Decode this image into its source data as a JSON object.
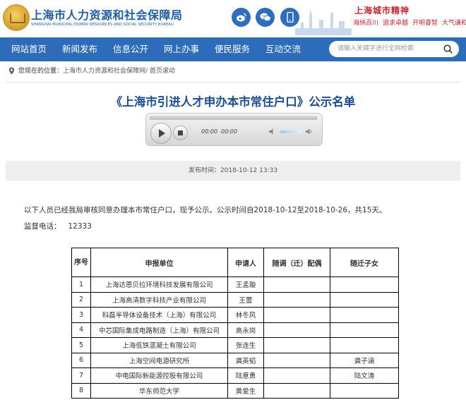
{
  "header": {
    "site_title": "上海市人力资源和社会保障局",
    "site_subtitle": "SHANGHAI MUNICIPAL HUMAN RESOURCES AND SOCIAL SECURITY BUREAU",
    "social_icons": [
      "weibo-icon",
      "wechat-icon",
      "mobile-icon"
    ],
    "spirit_title": "上海城市精神",
    "spirit_words": [
      "海纳百川",
      "追求卓越",
      "开明睿智",
      "大气谦和"
    ]
  },
  "nav": {
    "items": [
      "网站首页",
      "新闻发布",
      "信息公开",
      "网上办事",
      "便民服务",
      "互动交流"
    ],
    "search_placeholder": "请输入关键字进行全网检索"
  },
  "breadcrumb": {
    "label": "您现在的位置：",
    "path": "上海市人力资源和社会保障网/ 首页滚动"
  },
  "article": {
    "title": "《上海市引进人才申办本市常住户口》公示名单",
    "player": {
      "current_time": "00:00",
      "total_time": "00:00"
    },
    "publish_time": "发布时间：2018-10-12 13:33",
    "intro": "以下人员已经我局审核同意办理本市常住户口，现予公示。公示时间自2018-10-12至2018-10-26，共15天。",
    "phone_label": "监督电话：",
    "phone_number": "12333"
  },
  "table": {
    "headers": [
      "序号",
      "申报单位",
      "申请人",
      "随调（迁）配偶",
      "随迁子女"
    ],
    "rows": [
      [
        "1",
        "上海达恩贝拉环境科技发展有限公司",
        "王孟璇",
        "",
        ""
      ],
      [
        "2",
        "上海高清数字科技产业有限公司",
        "王蕾",
        "",
        ""
      ],
      [
        "3",
        "科磊半导体设备技术（上海）有限公司",
        "林冬风",
        "",
        ""
      ],
      [
        "4",
        "中芯国际集成电路制造（上海）有限公司",
        "高永岗",
        "",
        ""
      ],
      [
        "5",
        "上海佤铁混凝土有限公司",
        "张连生",
        "",
        ""
      ],
      [
        "6",
        "上海空间电源研究所",
        "龚英韬",
        "",
        "龚子涵"
      ],
      [
        "7",
        "中电国际新能源控股有限公司",
        "陆意勇",
        "",
        "陆文涛"
      ],
      [
        "8",
        "华东师范大学",
        "黄爱生",
        "",
        ""
      ]
    ]
  }
}
